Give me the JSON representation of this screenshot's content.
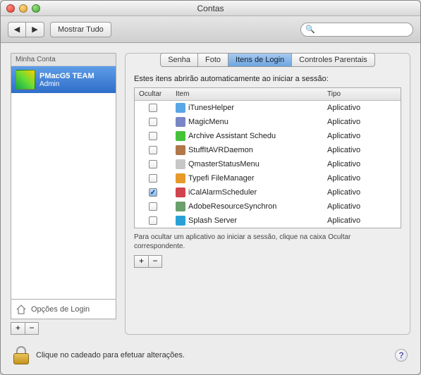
{
  "window": {
    "title": "Contas"
  },
  "toolbar": {
    "show_all_label": "Mostrar Tudo",
    "search_placeholder": ""
  },
  "sidebar": {
    "header": "Minha Conta",
    "account": {
      "name": "PMacG5 TEAM",
      "role": "Admin"
    },
    "login_options_label": "Opções de Login"
  },
  "tabs": {
    "items": [
      {
        "label": "Senha"
      },
      {
        "label": "Foto"
      },
      {
        "label": "Itens de Login"
      },
      {
        "label": "Controles Parentais"
      }
    ],
    "active_index": 2
  },
  "login_items": {
    "description": "Estes itens abrirão automaticamente ao iniciar a sessão:",
    "columns": {
      "hide": "Ocultar",
      "item": "Item",
      "type": "Tipo"
    },
    "rows": [
      {
        "hidden": false,
        "name": "iTunesHelper",
        "type": "Aplicativo",
        "icon_color": "#5aa7e6"
      },
      {
        "hidden": false,
        "name": "MagicMenu",
        "type": "Aplicativo",
        "icon_color": "#7a86c4"
      },
      {
        "hidden": false,
        "name": "Archive Assistant Schedu",
        "type": "Aplicativo",
        "icon_color": "#44c33a"
      },
      {
        "hidden": false,
        "name": "StuffItAVRDaemon",
        "type": "Aplicativo",
        "icon_color": "#b0774a"
      },
      {
        "hidden": false,
        "name": "QmasterStatusMenu",
        "type": "Aplicativo",
        "icon_color": "#c7c7c7"
      },
      {
        "hidden": false,
        "name": "Typefi FileManager",
        "type": "Aplicativo",
        "icon_color": "#e69a2a"
      },
      {
        "hidden": true,
        "name": "iCalAlarmScheduler",
        "type": "Aplicativo",
        "icon_color": "#d1444e"
      },
      {
        "hidden": false,
        "name": "AdobeResourceSynchron",
        "type": "Aplicativo",
        "icon_color": "#6aa06a"
      },
      {
        "hidden": false,
        "name": "Splash Server",
        "type": "Aplicativo",
        "icon_color": "#2aa1d6"
      }
    ],
    "hint": "Para ocultar um aplicativo ao iniciar a sessão, clique na caixa Ocultar correspondente."
  },
  "footer": {
    "lock_text": "Clique no cadeado para efetuar alterações."
  },
  "glyphs": {
    "plus": "+",
    "minus": "−",
    "back": "◀",
    "forward": "▶",
    "search": "🔍",
    "help": "?"
  }
}
